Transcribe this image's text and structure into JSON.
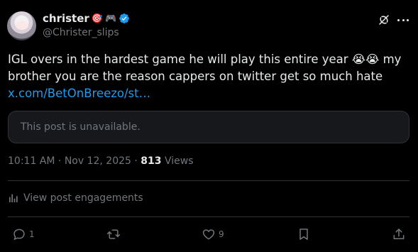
{
  "author": {
    "display_name": "christer",
    "name_emojis": [
      "🎯",
      "🎮"
    ],
    "handle": "@Christer_slips",
    "verified": true
  },
  "tweet": {
    "text_main": "IGL overs in the hardest game he will play this entire year 😭😭 my brother you are the reason cappers on twitter get so much hate",
    "link_text": "x.com/BetOnBreezo/st…",
    "quote_unavailable": "This post is unavailable."
  },
  "meta": {
    "time": "10:11 AM",
    "date": "Nov 12, 2025",
    "separator": "·",
    "views_count": "813",
    "views_label": "Views"
  },
  "engagements_label": "View post engagements",
  "actions": {
    "reply_count": "1",
    "retweet_count": "",
    "like_count": "9"
  },
  "icons": [
    "grok-icon",
    "more-icon",
    "verified-icon",
    "analytics-icon",
    "reply-icon",
    "retweet-icon",
    "like-icon",
    "bookmark-icon",
    "share-icon"
  ],
  "colors": {
    "background": "#000000",
    "text": "#e7e9ea",
    "muted": "#71767b",
    "link": "#1d9bf0",
    "border": "#2f3336"
  }
}
